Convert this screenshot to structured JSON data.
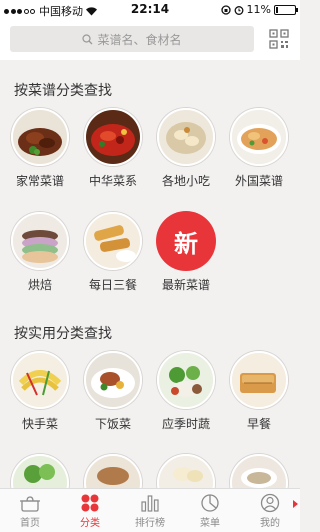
{
  "status_bar": {
    "carrier": "中国移动",
    "wifi_icon": "wifi-icon",
    "time": "22:14",
    "battery": "11%",
    "battery_level": 0.11,
    "lock_icon": "orientation-lock-icon",
    "alarm_icon": "alarm-icon"
  },
  "search": {
    "placeholder": "菜谱名、食材名",
    "qr_icon": "qr-code-icon"
  },
  "sections": [
    {
      "title": "按菜谱分类查找",
      "items": [
        {
          "label": "家常菜谱"
        },
        {
          "label": "中华菜系"
        },
        {
          "label": "各地小吃"
        },
        {
          "label": "外国菜谱"
        },
        {
          "label": "烘焙"
        },
        {
          "label": "每日三餐"
        },
        {
          "label": "最新菜谱",
          "badge": "新"
        }
      ]
    },
    {
      "title": "按实用分类查找",
      "items": [
        {
          "label": "快手菜"
        },
        {
          "label": "下饭菜"
        },
        {
          "label": "应季时蔬"
        },
        {
          "label": "早餐"
        }
      ]
    }
  ],
  "tabs": [
    {
      "label": "首页",
      "icon": "pot-icon"
    },
    {
      "label": "分类",
      "icon": "category-dots-icon",
      "active": true
    },
    {
      "label": "排行榜",
      "icon": "bar-chart-icon"
    },
    {
      "label": "菜单",
      "icon": "menu-pie-icon"
    },
    {
      "label": "我的",
      "icon": "user-icon"
    }
  ],
  "colors": {
    "accent": "#e8353a",
    "background": "#f3f1f0",
    "tab_inactive": "#8a8a8a"
  }
}
